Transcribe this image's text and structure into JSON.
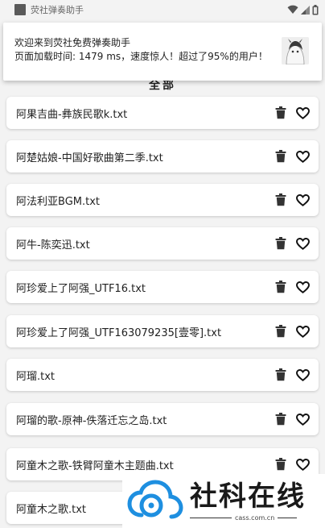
{
  "status_bar": {
    "title": "荧社弹奏助手"
  },
  "section_title": "全部",
  "toast": {
    "line1": "欢迎来到荧社免费弹奏助手",
    "line2": "页面加载时间: 1479 ms，速度惊人！超过了95%的用户！"
  },
  "songs": [
    "阿果吉曲-彝族民歌k.txt",
    "阿楚姑娘-中国好歌曲第二季.txt",
    "阿法利亚BGM.txt",
    "阿牛-陈奕迅.txt",
    "阿珍爱上了阿强_UTF16.txt",
    "阿珍爱上了阿强_UTF163079235[壹零].txt",
    "阿瑠.txt",
    "阿瑠的歌-原神-佚落迁忘之岛.txt",
    "阿童木之歌-铁臂阿童木主题曲.txt",
    "阿童木之歌.txt"
  ],
  "icons": {
    "delete": "trash-icon",
    "favorite": "heart-outline-icon"
  },
  "watermark": {
    "title": "社科在线",
    "domain": "cass.com.cn"
  },
  "colors": {
    "accent": "#1e8fe0",
    "text": "#222222",
    "background": "#f3f3f3"
  }
}
